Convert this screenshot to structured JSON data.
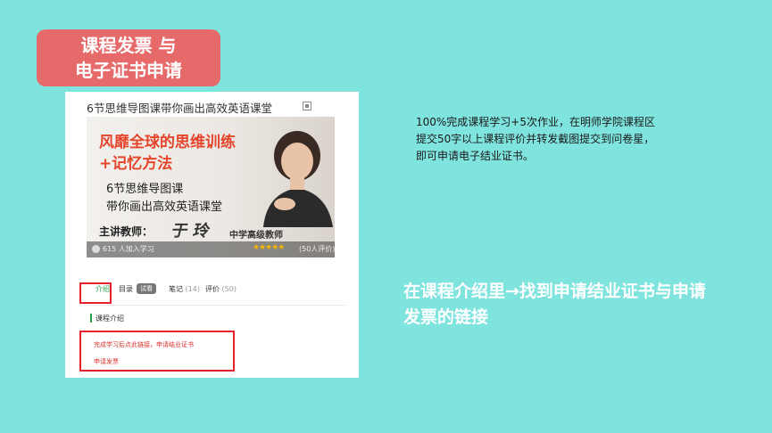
{
  "title": {
    "line1": "课程发票 与",
    "line2": "电子证书申请"
  },
  "course_card": {
    "course_title": "6节思维导图课带你画出高效英语课堂",
    "banner": {
      "headline1": "风靡全球的思维训练",
      "headline2": "+记忆方法",
      "subtitle1": "6节思维导图课",
      "subtitle2": "带你画出高效英语课堂",
      "teacher_label": "主讲教师：",
      "teacher_signature": "于 玲",
      "teacher_role": "中学高级教师",
      "joined": "615 人加入学习",
      "stars": "★★★★★",
      "reviews": "(50人评价)"
    },
    "tabs": {
      "intro": "介绍",
      "directory": "目录",
      "directory_badge": "试看",
      "notes": "笔记",
      "notes_count": "(14)",
      "review": "评价",
      "review_count": "(50)"
    },
    "section_title": "课程介绍",
    "link_certificate": "完成学习后点此链接，申请结业证书",
    "link_invoice": "申请发票"
  },
  "description": "100%完成课程学习+5次作业，在明师学院课程区提交50字以上课程评价并转发截图提交到问卷星，即可申请电子结业证书。",
  "callout": "在课程介绍里→找到申请结业证书与申请发票的链接",
  "colors": {
    "background": "#7fe3de",
    "title_badge": "#e76a6b",
    "highlight_box": "#e4202a",
    "accent_green": "#2ca14b"
  }
}
